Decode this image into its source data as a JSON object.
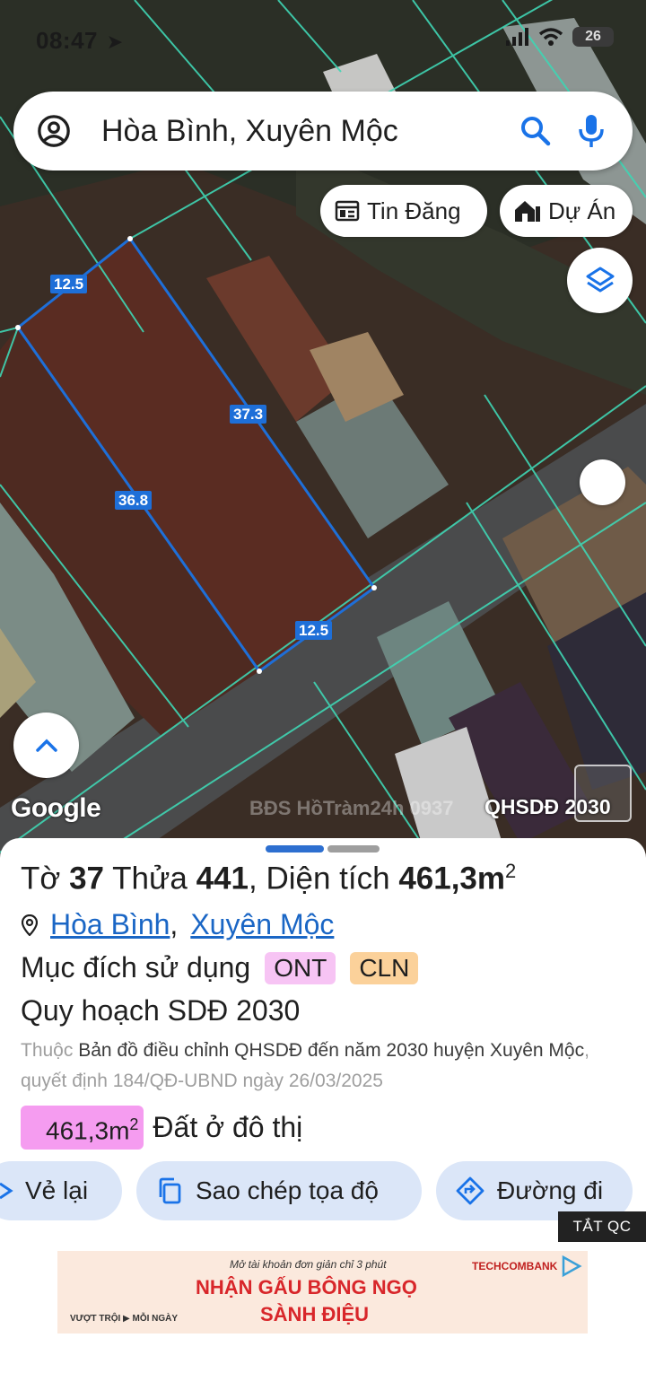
{
  "status_bar": {
    "time": "08:47",
    "battery": "26"
  },
  "search": {
    "query": "Hòa Bình, Xuyên Mộc"
  },
  "chips": {
    "listings": "Tin Đăng",
    "projects": "Dự Án"
  },
  "map": {
    "dimensions": {
      "top": "12.5",
      "right_side": "37.3",
      "left_side": "36.8",
      "bottom": "12.5"
    },
    "watermark": "BĐS HồTràm24h 0937",
    "layer_label": "QHSDĐ 2030",
    "google_logo": "Google",
    "colors": {
      "parcel": "#1e6fd8",
      "boundary": "#3fd6b4"
    }
  },
  "parcel": {
    "title_prefix": "Tờ",
    "sheet_no": "37",
    "plot_prefix": "Thửa",
    "plot_no": "441",
    "area_prefix": ", Diện tích",
    "area": "461,3m",
    "area_unit_sup": "2",
    "ward": "Hòa Bình",
    "district": "Xuyên Mộc",
    "purpose_label": "Mục đích sử dụng",
    "purpose_tags": [
      "ONT",
      "CLN"
    ],
    "plan_label": "Quy hoạch SDĐ 2030",
    "desc_prefix": "Thuộc",
    "desc_main": "Bản đồ điều chỉnh QHSDĐ đến năm 2030 huyện Xuyên Mộc",
    "desc_suffix": ", quyết định 184/QĐ-UBND ngày 26/03/2025",
    "zone_area": "461,3m",
    "zone_area_sup": "2",
    "zone_label": "Đất ở đô thị"
  },
  "actions": {
    "redraw": "Vẻ lại",
    "copy_coords": "Sao chép tọa độ",
    "directions": "Đường đi"
  },
  "ad": {
    "close_label": "TẮT QC",
    "line1": "Mở tài khoản đơn giản chỉ 3 phút",
    "bank": "TECHCOMBANK",
    "line2": "NHẬN GẤU BÔNG NGỌ",
    "line3": "SÀNH ĐIỆU",
    "tagline": "VƯỢT TRỘI ▶ MỖI NGÀY"
  }
}
